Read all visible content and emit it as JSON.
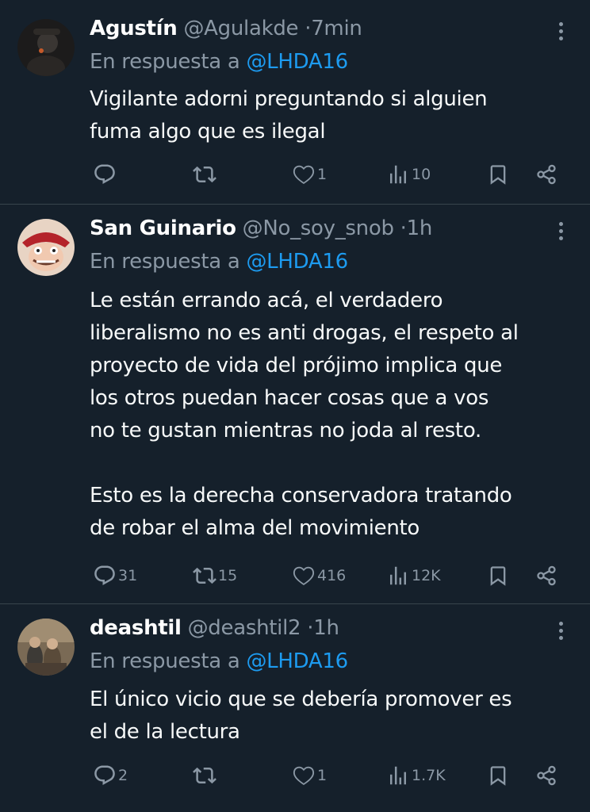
{
  "tweets": [
    {
      "name": "Agustín",
      "handle": "@Agulakde",
      "dot": "·",
      "time": "7min",
      "reply_prefix": "En respuesta a",
      "reply_to": "@LHDA16",
      "text": "Vigilante adorni preguntando si alguien\nfuma algo que es ilegal",
      "replies": "",
      "retweets": "",
      "likes": "1",
      "views": "10"
    },
    {
      "name": "San Guinario",
      "handle": "@No_soy_snob",
      "dot": "·",
      "time": "1h",
      "reply_prefix": "En respuesta a",
      "reply_to": "@LHDA16",
      "text": "Le están errando acá, el verdadero\nliberalismo no es anti drogas, el respeto al\nproyecto de vida del prójimo implica que\nlos otros puedan hacer cosas que a vos\nno te gustan mientras no joda al resto.\n\nEsto es la derecha conservadora tratando\nde robar el alma del movimiento",
      "replies": "31",
      "retweets": "15",
      "likes": "416",
      "views": "12K"
    },
    {
      "name": "deashtil",
      "handle": "@deashtil2",
      "dot": "·",
      "time": "1h",
      "reply_prefix": "En respuesta a",
      "reply_to": "@LHDA16",
      "text": "El único vicio que se debería promover es\nel de la lectura",
      "replies": "2",
      "retweets": "",
      "likes": "1",
      "views": "1.7K"
    }
  ],
  "icons": {
    "reply": "reply-icon",
    "retweet": "retweet-icon",
    "like": "heart-icon",
    "views": "views-icon",
    "bookmark": "bookmark-icon",
    "share": "share-icon",
    "more": "more-icon"
  },
  "colors": {
    "background": "#15202b",
    "text": "#f7f9f9",
    "secondary": "#8b98a5",
    "link": "#1d9bf0",
    "divider": "#38444d"
  }
}
